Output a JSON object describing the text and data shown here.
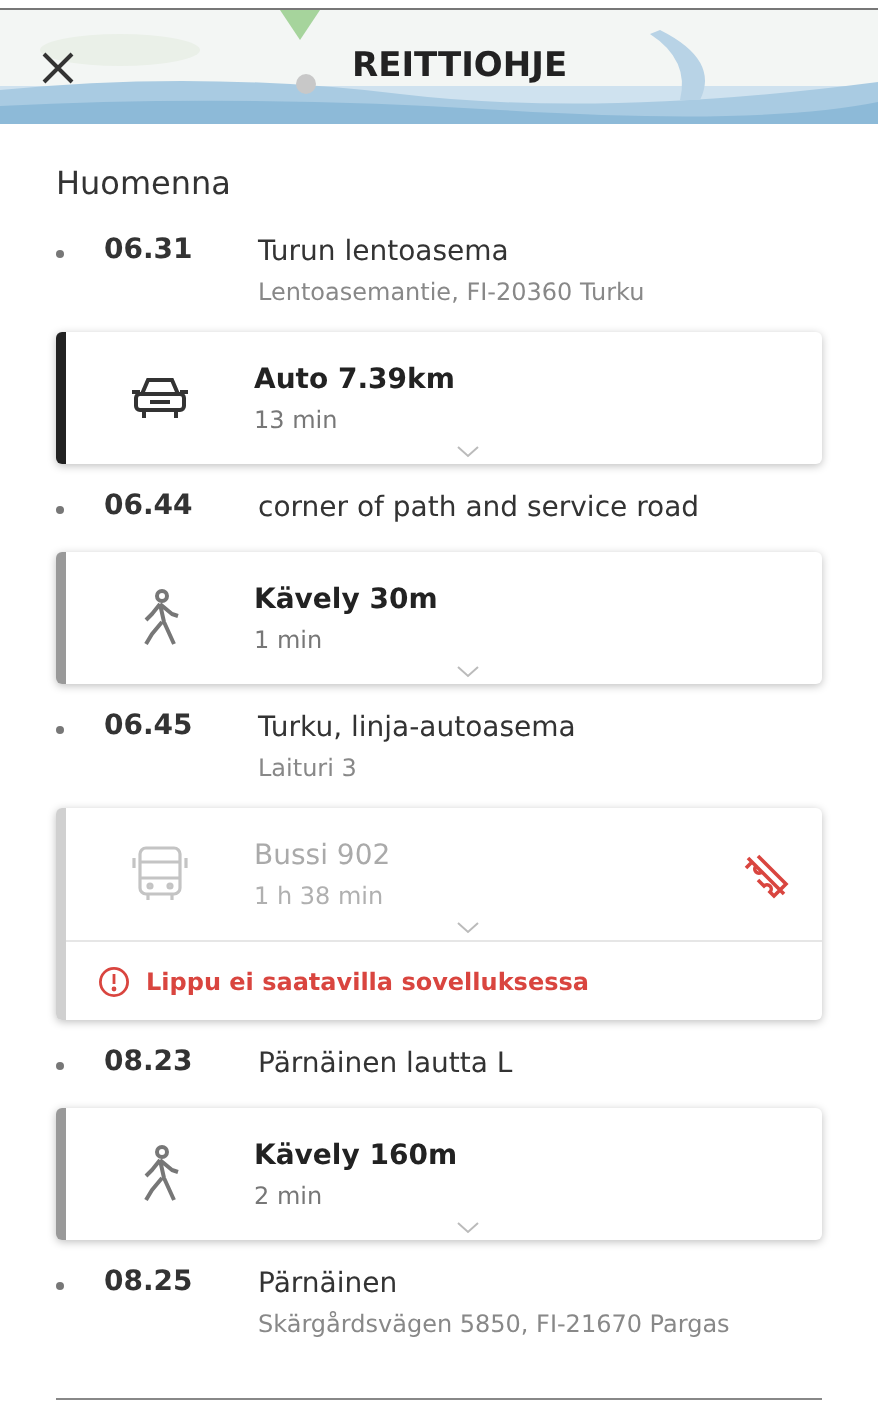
{
  "header": {
    "title": "REITTIOHJE"
  },
  "day": "Huomenna",
  "items": [
    {
      "kind": "stop",
      "time": "06.31",
      "name": "Turun lentoasema",
      "address": "Lentoasemantie, FI-20360 Turku"
    },
    {
      "kind": "car",
      "title": "Auto 7.39km",
      "duration": "13 min",
      "disabled": false
    },
    {
      "kind": "stop",
      "time": "06.44",
      "name": "corner of path and service road"
    },
    {
      "kind": "walk",
      "title": "Kävely 30m",
      "duration": "1 min",
      "disabled": false
    },
    {
      "kind": "stop",
      "time": "06.45",
      "name": "Turku, linja-autoasema",
      "address": "Laituri 3"
    },
    {
      "kind": "bus",
      "title": "Bussi 902",
      "duration": "1 h 38 min",
      "disabled": true,
      "warning": "Lippu ei saatavilla sovelluksessa"
    },
    {
      "kind": "stop",
      "time": "08.23",
      "name": "Pärnäinen lautta L"
    },
    {
      "kind": "walk",
      "title": "Kävely 160m",
      "duration": "2 min",
      "disabled": false
    },
    {
      "kind": "stop",
      "time": "08.25",
      "name": "Pärnäinen",
      "address": "Skärgårdsvägen 5850, FI-21670 Pargas"
    }
  ]
}
